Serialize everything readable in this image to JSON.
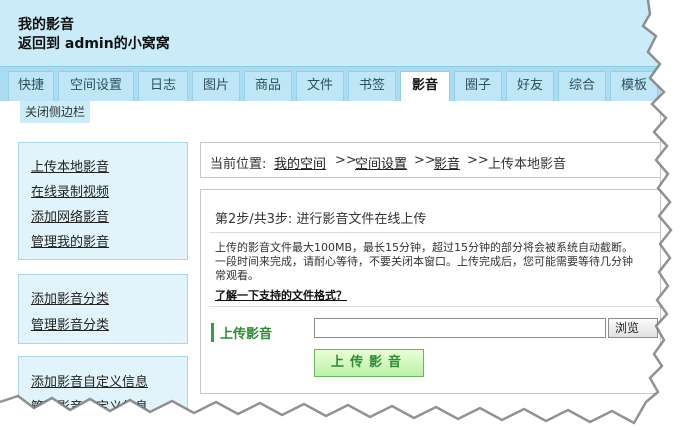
{
  "header": {
    "title": "我的影音",
    "subtitle": "返回到 admin的小窝窝"
  },
  "nav": {
    "tabs": [
      "快捷",
      "空间设置",
      "日志",
      "图片",
      "商品",
      "文件",
      "书签",
      "影音",
      "圈子",
      "好友",
      "综合",
      "模板"
    ],
    "active": "影音"
  },
  "sidebar_toggle": "关闭侧边栏",
  "sidebar": {
    "group1": [
      "上传本地影音",
      "在线录制视频",
      "添加网络影音",
      "管理我的影音"
    ],
    "group2": [
      "添加影音分类",
      "管理影音分类"
    ],
    "group3": [
      "添加影音自定义信息",
      "管理影音自定义信息"
    ]
  },
  "breadcrumb": {
    "label": "当前位置:",
    "items": [
      "我的空间",
      "空间设置",
      "影音",
      "上传本地影音"
    ],
    "sep": ">>"
  },
  "main": {
    "step": "第2步/共3步: 进行影音文件在线上传",
    "info_line1": "上传的影音文件最大100MB，最长15分钟，超过15分钟的部分将会被系统自动截断。",
    "info_line2": "一段时间来完成，请耐心等待，不要关闭本窗口。上传完成后，您可能需要等待几分钟",
    "info_line3": "常观看。",
    "formats_link": "了解一下支持的文件格式？",
    "upload_label": "上传影音",
    "file_value": "",
    "browse_label": "浏览",
    "submit_label": "上传影音"
  },
  "colors": {
    "header_bg": "#c9ecf8",
    "nav_bg": "#a9dcf2",
    "panel_bg": "#e2f4fb",
    "accent_green": "#2a8d34"
  }
}
